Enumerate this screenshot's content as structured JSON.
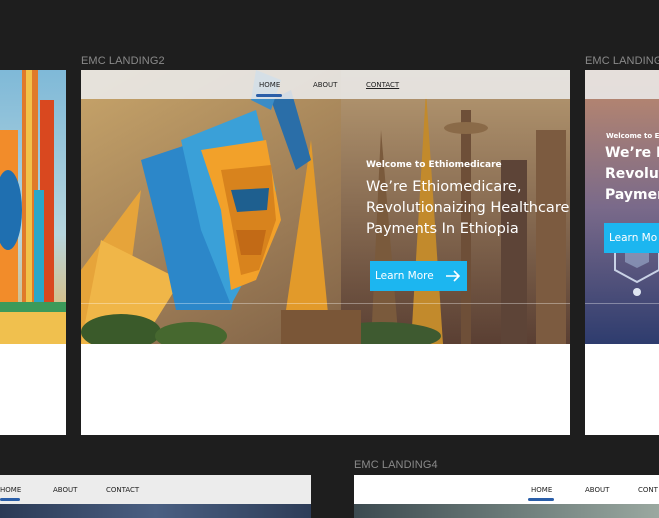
{
  "frames": {
    "landing2": {
      "title": "EMC LANDING2",
      "nav": {
        "home": "HOME",
        "about": "ABOUT",
        "contact": "CONTACT"
      },
      "hero": {
        "kicker": "Welcome to Ethiomedicare",
        "headline": "We’re Ethiomedicare, Revolutionaizing Healthcare Payments In Ethiopia",
        "cta": "Learn More"
      }
    },
    "landing3": {
      "title": "EMC LANDING3",
      "hero": {
        "kicker": "Welcome to Et",
        "headline_lines": [
          "We’re E",
          "Revolut",
          "Paymen"
        ],
        "cta": "Learn Mo"
      }
    },
    "bottom_left": {
      "nav": {
        "home": "HOME",
        "about": "ABOUT",
        "contact": "CONTACT"
      }
    },
    "landing4": {
      "title": "EMC LANDING4",
      "nav": {
        "home": "HOME",
        "about": "ABOUT",
        "contact": "CONT"
      }
    }
  },
  "colors": {
    "canvas": "#1e1e1e",
    "accent_button": "#1cb6f0",
    "nav_underline": "#2a5ea8",
    "frame_label": "#8a8a8a"
  }
}
